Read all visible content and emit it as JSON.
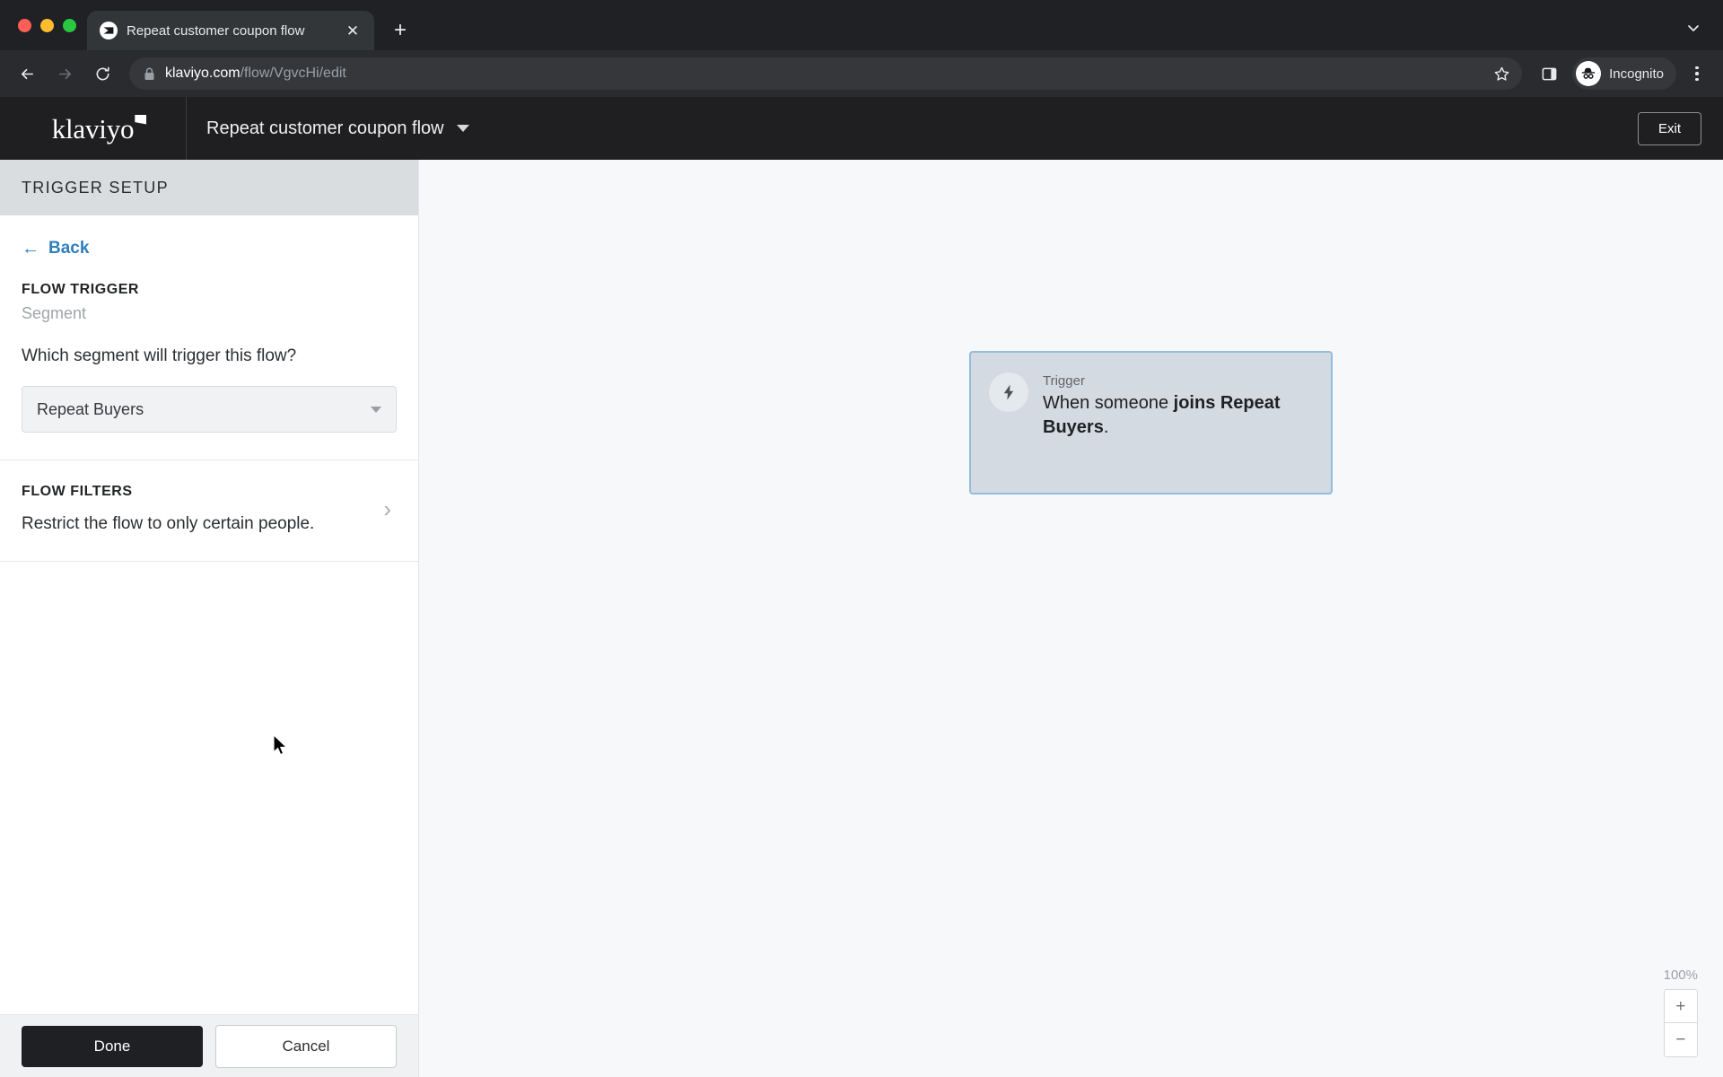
{
  "browser": {
    "window_controls": [
      "close",
      "minimize",
      "maximize"
    ],
    "tab": {
      "title": "Repeat customer coupon flow",
      "favicon_name": "klaviyo-favicon",
      "close_label": "✕"
    },
    "new_tab_label": "+",
    "tab_list_chevron": "chevron-down",
    "nav": {
      "back_label": "←",
      "forward_label": "→",
      "reload_label": "↻"
    },
    "omnibox": {
      "url_domain": "klaviyo.com",
      "url_path": "/flow/VgvcHi/edit",
      "lock_icon": "lock-icon",
      "bookmark_icon": "star-icon"
    },
    "side_panel_icon": "side-panel-icon",
    "profile": {
      "label": "Incognito",
      "icon": "incognito-icon"
    },
    "menu_icon": "kebab-menu-icon"
  },
  "appbar": {
    "brand": "klaviyo",
    "flow_name": "Repeat customer coupon flow",
    "flow_name_caret": "chevron-down-icon",
    "exit_label": "Exit"
  },
  "sidebar": {
    "header_title": "TRIGGER SETUP",
    "back_label": "Back",
    "flow_trigger": {
      "heading": "FLOW TRIGGER",
      "type": "Segment",
      "question": "Which segment will trigger this flow?",
      "selected_segment": "Repeat Buyers"
    },
    "flow_filters": {
      "heading": "FLOW FILTERS",
      "description": "Restrict the flow to only certain people."
    },
    "footer": {
      "done_label": "Done",
      "cancel_label": "Cancel"
    }
  },
  "canvas": {
    "trigger_card": {
      "kicker": "Trigger",
      "sentence_prefix": "When someone ",
      "sentence_strong": "joins Repeat Buyers",
      "sentence_suffix": ".",
      "icon": "lightning-bolt-icon"
    },
    "zoom": {
      "level": "100%",
      "zoom_in_label": "+",
      "zoom_out_label": "−"
    }
  },
  "colors": {
    "accent_blue": "#2f7ebd",
    "card_bg": "#d3dae2",
    "card_border": "#93bcdd",
    "appbar_bg": "#1f1f22",
    "canvas_bg": "#f7f8fa",
    "sidebar_header_bg": "#dadde0",
    "done_button_bg": "#1f2024"
  }
}
